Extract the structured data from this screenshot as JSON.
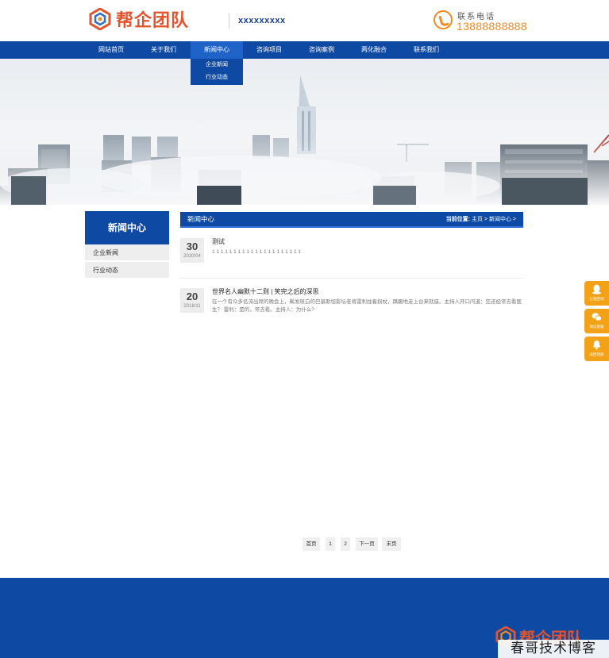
{
  "brand": {
    "name": "帮企团队",
    "slogan": "xxxxxxxxx",
    "accent": "#0e4aa3",
    "logo_color": "#e2542b"
  },
  "contact": {
    "label": "联系电话",
    "number": "13888888888",
    "color": "#f08a1f"
  },
  "nav": {
    "items": [
      {
        "label": "网站首页"
      },
      {
        "label": "关于我们"
      },
      {
        "label": "新闻中心",
        "active": true
      },
      {
        "label": "咨询项目"
      },
      {
        "label": "咨询案例"
      },
      {
        "label": "两化融合"
      },
      {
        "label": "联系我们"
      }
    ],
    "dropdown": [
      {
        "label": "企业新闻"
      },
      {
        "label": "行业动态"
      }
    ]
  },
  "sidebar": {
    "title": "新闻中心",
    "items": [
      {
        "label": "企业新闻"
      },
      {
        "label": "行业动态"
      }
    ]
  },
  "content": {
    "title": "新闻中心",
    "breadcrumb": {
      "prefix": "当前位置:",
      "trail": "主页 > 新闻中心 >"
    },
    "news": [
      {
        "day": "30",
        "ym": "2020/04",
        "title": "测试",
        "desc": "1 1 1 1 1 1 1 1 1 1 1 1 1 1 1 1 1 1 1 1 1"
      },
      {
        "day": "20",
        "ym": "2018/11",
        "title": "世界名人幽默十二则 | 笑完之后的深思",
        "desc": "在一个有众多名流出席的晚会上，鬓发斑白的巴基斯坦影坛老将雷利拄着拐杖，蹒跚地走上台来就座。主持人开口问道：您还经常去看医生？ 雷利：是的，常去看。主持人：为什么?"
      }
    ]
  },
  "pager": {
    "first": "首页",
    "p1": "1",
    "p2": "2",
    "next": "下一页",
    "last": "末页"
  },
  "side_tools": [
    {
      "label": "在线咨询",
      "icon": "qq-icon"
    },
    {
      "label": "微信客服",
      "icon": "wechat-icon"
    },
    {
      "label": "返回顶部",
      "icon": "bell-icon"
    }
  ],
  "footer": {
    "logo_text": "帮企团队"
  },
  "watermark": "春哥技术博客"
}
